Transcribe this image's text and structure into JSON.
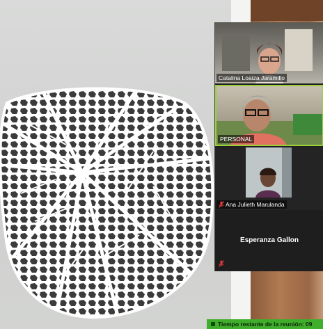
{
  "meeting": {
    "participants": [
      {
        "name": "Catalina Loaiza Jaramillo",
        "muted": false
      },
      {
        "name": "PERSONAL",
        "muted": false,
        "active_speaker": true
      },
      {
        "name": "Ana Julieth Marulanda",
        "muted": true
      },
      {
        "name": "Esperanza Gallon",
        "muted": true,
        "video_off": true
      }
    ],
    "timer": {
      "label": "Tiempo restante de la reunión:",
      "value": "09"
    }
  },
  "colors": {
    "active_speaker_border": "#9ad13a",
    "timer_bar": "#3fae2a",
    "mute_icon": "#e03b3b"
  }
}
